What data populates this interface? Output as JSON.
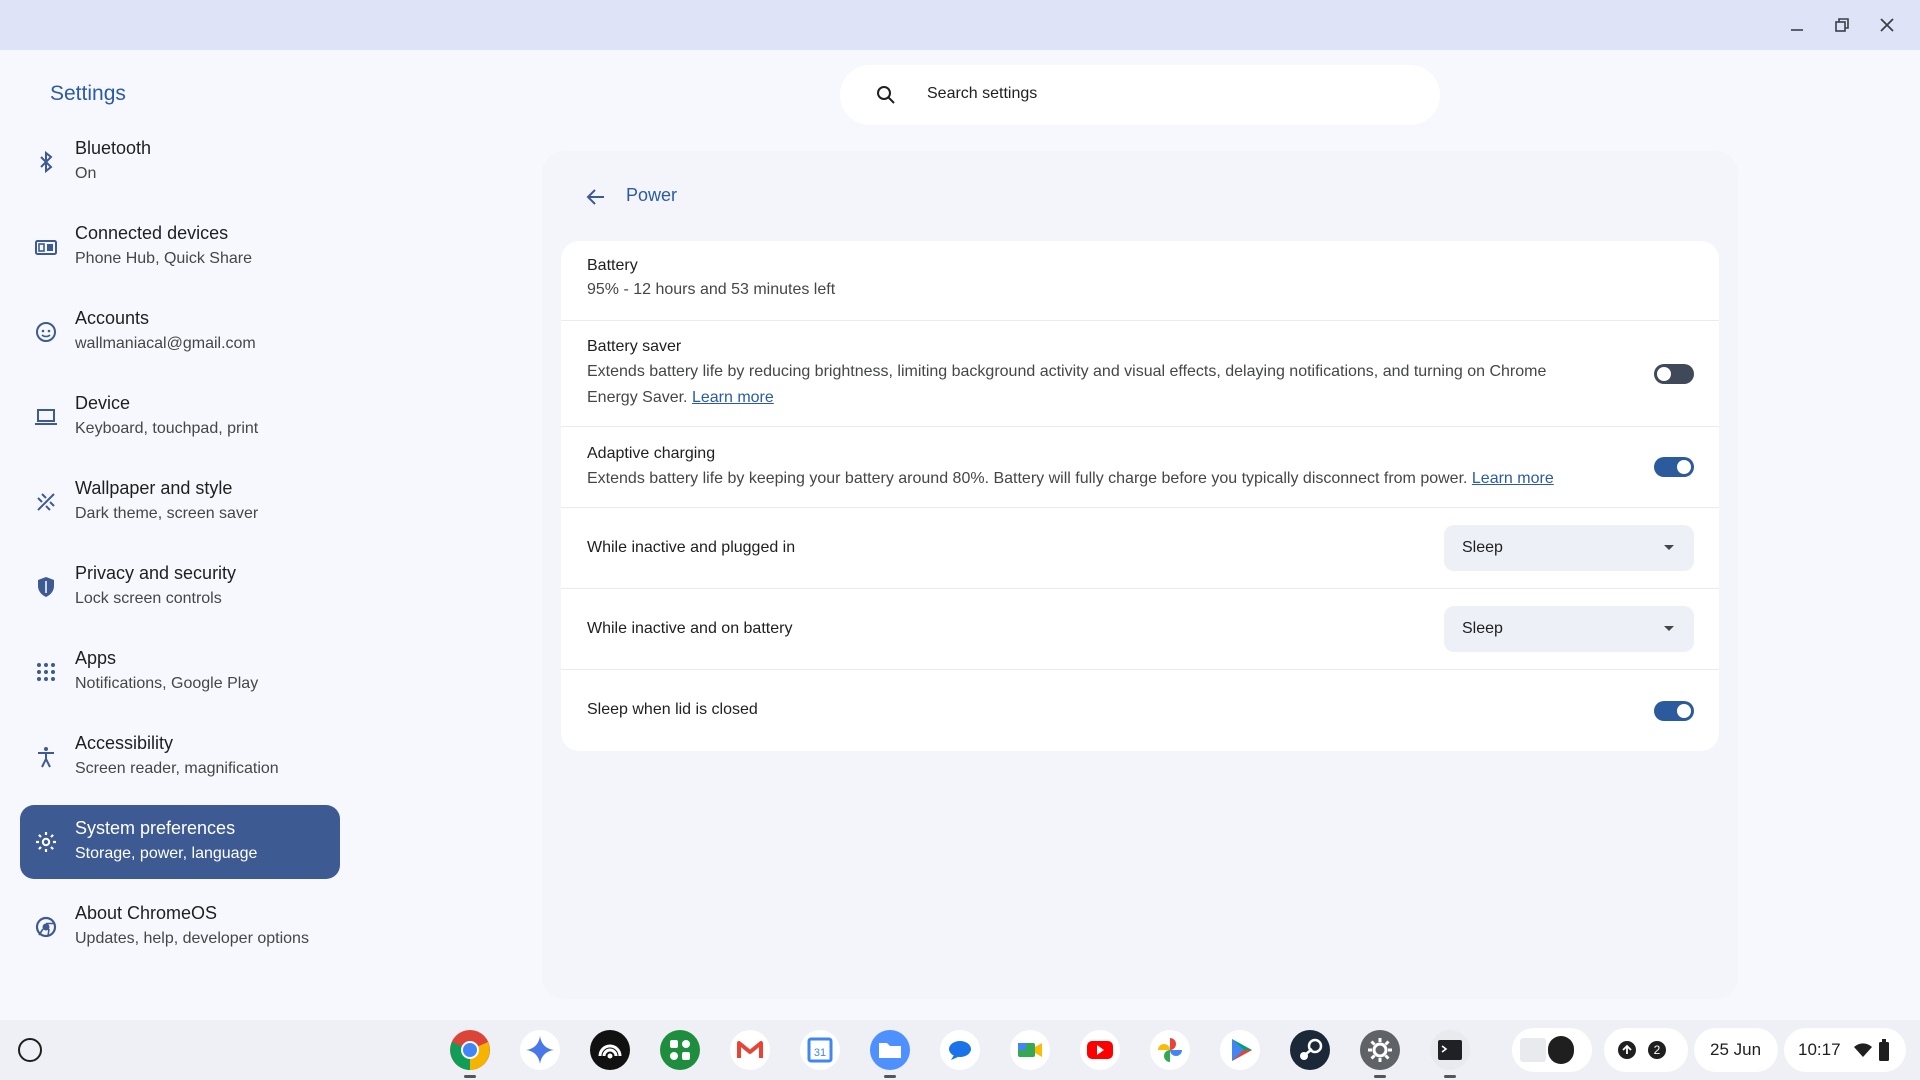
{
  "app": {
    "title": "Settings"
  },
  "search": {
    "placeholder": "Search settings"
  },
  "sidebar": {
    "items": [
      {
        "title": "Bluetooth",
        "subtitle": "On",
        "icon": "bluetooth-icon"
      },
      {
        "title": "Connected devices",
        "subtitle": "Phone Hub, Quick Share",
        "icon": "connected-devices-icon"
      },
      {
        "title": "Accounts",
        "subtitle": "wallmaniacal@gmail.com",
        "icon": "account-icon"
      },
      {
        "title": "Device",
        "subtitle": "Keyboard, touchpad, print",
        "icon": "laptop-icon"
      },
      {
        "title": "Wallpaper and style",
        "subtitle": "Dark theme, screen saver",
        "icon": "paint-icon"
      },
      {
        "title": "Privacy and security",
        "subtitle": "Lock screen controls",
        "icon": "shield-icon"
      },
      {
        "title": "Apps",
        "subtitle": "Notifications, Google Play",
        "icon": "apps-grid-icon"
      },
      {
        "title": "Accessibility",
        "subtitle": "Screen reader, magnification",
        "icon": "accessibility-icon"
      },
      {
        "title": "System preferences",
        "subtitle": "Storage, power, language",
        "icon": "gear-icon",
        "active": true
      },
      {
        "title": "About ChromeOS",
        "subtitle": "Updates, help, developer options",
        "icon": "chromeos-icon"
      }
    ]
  },
  "main": {
    "page_title": "Power",
    "battery": {
      "title": "Battery",
      "status": "95% - 12 hours and 53 minutes left"
    },
    "battery_saver": {
      "title": "Battery saver",
      "desc": "Extends battery life by reducing brightness, limiting background activity and visual effects, delaying notifications, and turning on Chrome Energy Saver.",
      "link": "Learn more",
      "enabled": false
    },
    "adaptive_charging": {
      "title": "Adaptive charging",
      "desc": "Extends battery life by keeping your battery around 80%. Battery will fully charge before you typically disconnect from power.",
      "link": "Learn more",
      "enabled": true
    },
    "inactive_plugged": {
      "title": "While inactive and plugged in",
      "value": "Sleep"
    },
    "inactive_battery": {
      "title": "While inactive and on battery",
      "value": "Sleep"
    },
    "lid_sleep": {
      "title": "Sleep when lid is closed",
      "enabled": true
    }
  },
  "shelf": {
    "apps": [
      "chrome",
      "gemini",
      "podcast",
      "apps-launcher",
      "gmail",
      "calendar",
      "files",
      "messages",
      "meet",
      "youtube",
      "photos",
      "play-store",
      "steam",
      "settings",
      "terminal"
    ],
    "calendar_day": "31",
    "notification_count": "2",
    "date": "25 Jun",
    "time": "10:17"
  },
  "colors": {
    "accent": "#2b5aa8",
    "active_nav": "#3d5a92",
    "titlebar": "#dfe3f7"
  }
}
